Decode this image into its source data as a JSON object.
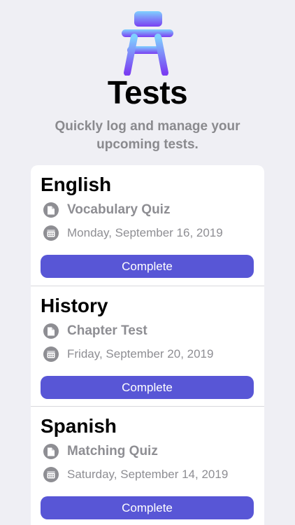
{
  "header": {
    "icon": "school-desk-icon",
    "title": "Tests",
    "subtitle": "Quickly log and manage your upcoming tests."
  },
  "colors": {
    "background": "#efeff4",
    "card": "#ffffff",
    "accent": "#5856d6",
    "secondary_text": "#8e8e93",
    "icon_gradient_top": "#7fd0ff",
    "icon_gradient_bottom": "#7a3ff2"
  },
  "tests": [
    {
      "subject": "English",
      "type": "Vocabulary Quiz",
      "type_icon": "document-icon",
      "date": "Monday, September 16, 2019",
      "date_icon": "calendar-icon",
      "action": "Complete"
    },
    {
      "subject": "History",
      "type": "Chapter Test",
      "type_icon": "document-icon",
      "date": "Friday, September 20, 2019",
      "date_icon": "calendar-icon",
      "action": "Complete"
    },
    {
      "subject": "Spanish",
      "type": "Matching Quiz",
      "type_icon": "document-icon",
      "date": "Saturday, September 14, 2019",
      "date_icon": "calendar-icon",
      "action": "Complete"
    }
  ]
}
